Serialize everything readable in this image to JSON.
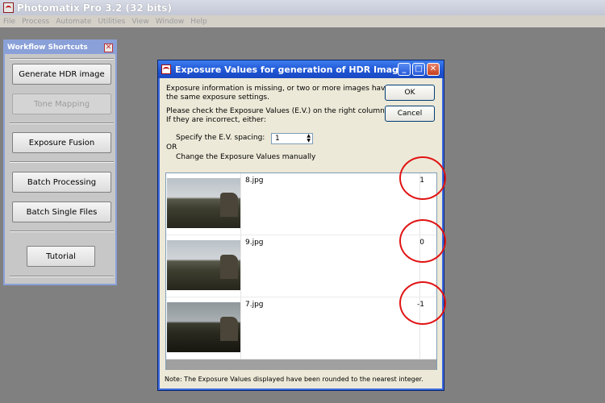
{
  "app": {
    "title": "Photomatix Pro 3.2 (32 bits)",
    "menu": [
      "File",
      "Process",
      "Automate",
      "Utilities",
      "View",
      "Window",
      "Help"
    ]
  },
  "workflow": {
    "title": "Workflow Shortcuts",
    "buttons": {
      "generate_hdr": "Generate HDR image",
      "tone_mapping": "Tone Mapping",
      "exposure_fusion": "Exposure Fusion",
      "batch_processing": "Batch Processing",
      "batch_single": "Batch Single Files",
      "tutorial": "Tutorial"
    }
  },
  "dialog": {
    "title": "Exposure Values for generation of HDR Image",
    "message1_line1": "Exposure information is missing, or two or more images have",
    "message1_line2": "the same exposure settings.",
    "message2_line1": "Please check the Exposure Values (E.V.) on the right column.",
    "message2_line2": "If they are incorrect, either:",
    "ev_spacing_label": "Specify the E.V. spacing:",
    "ev_spacing_value": "1",
    "or_label": "OR",
    "manual_label": "Change the Exposure Values manually",
    "ok": "OK",
    "cancel": "Cancel",
    "images": [
      {
        "file": "8.jpg",
        "ev": "1"
      },
      {
        "file": "9.jpg",
        "ev": "0"
      },
      {
        "file": "7.jpg",
        "ev": "-1"
      }
    ],
    "footnote": "Note: The Exposure Values displayed have been rounded to the nearest integer."
  },
  "colors": {
    "highlight_circle": "#e11414",
    "dialog_title_blue": "#1f54d2",
    "workflow_title": "#8aa0d8"
  }
}
